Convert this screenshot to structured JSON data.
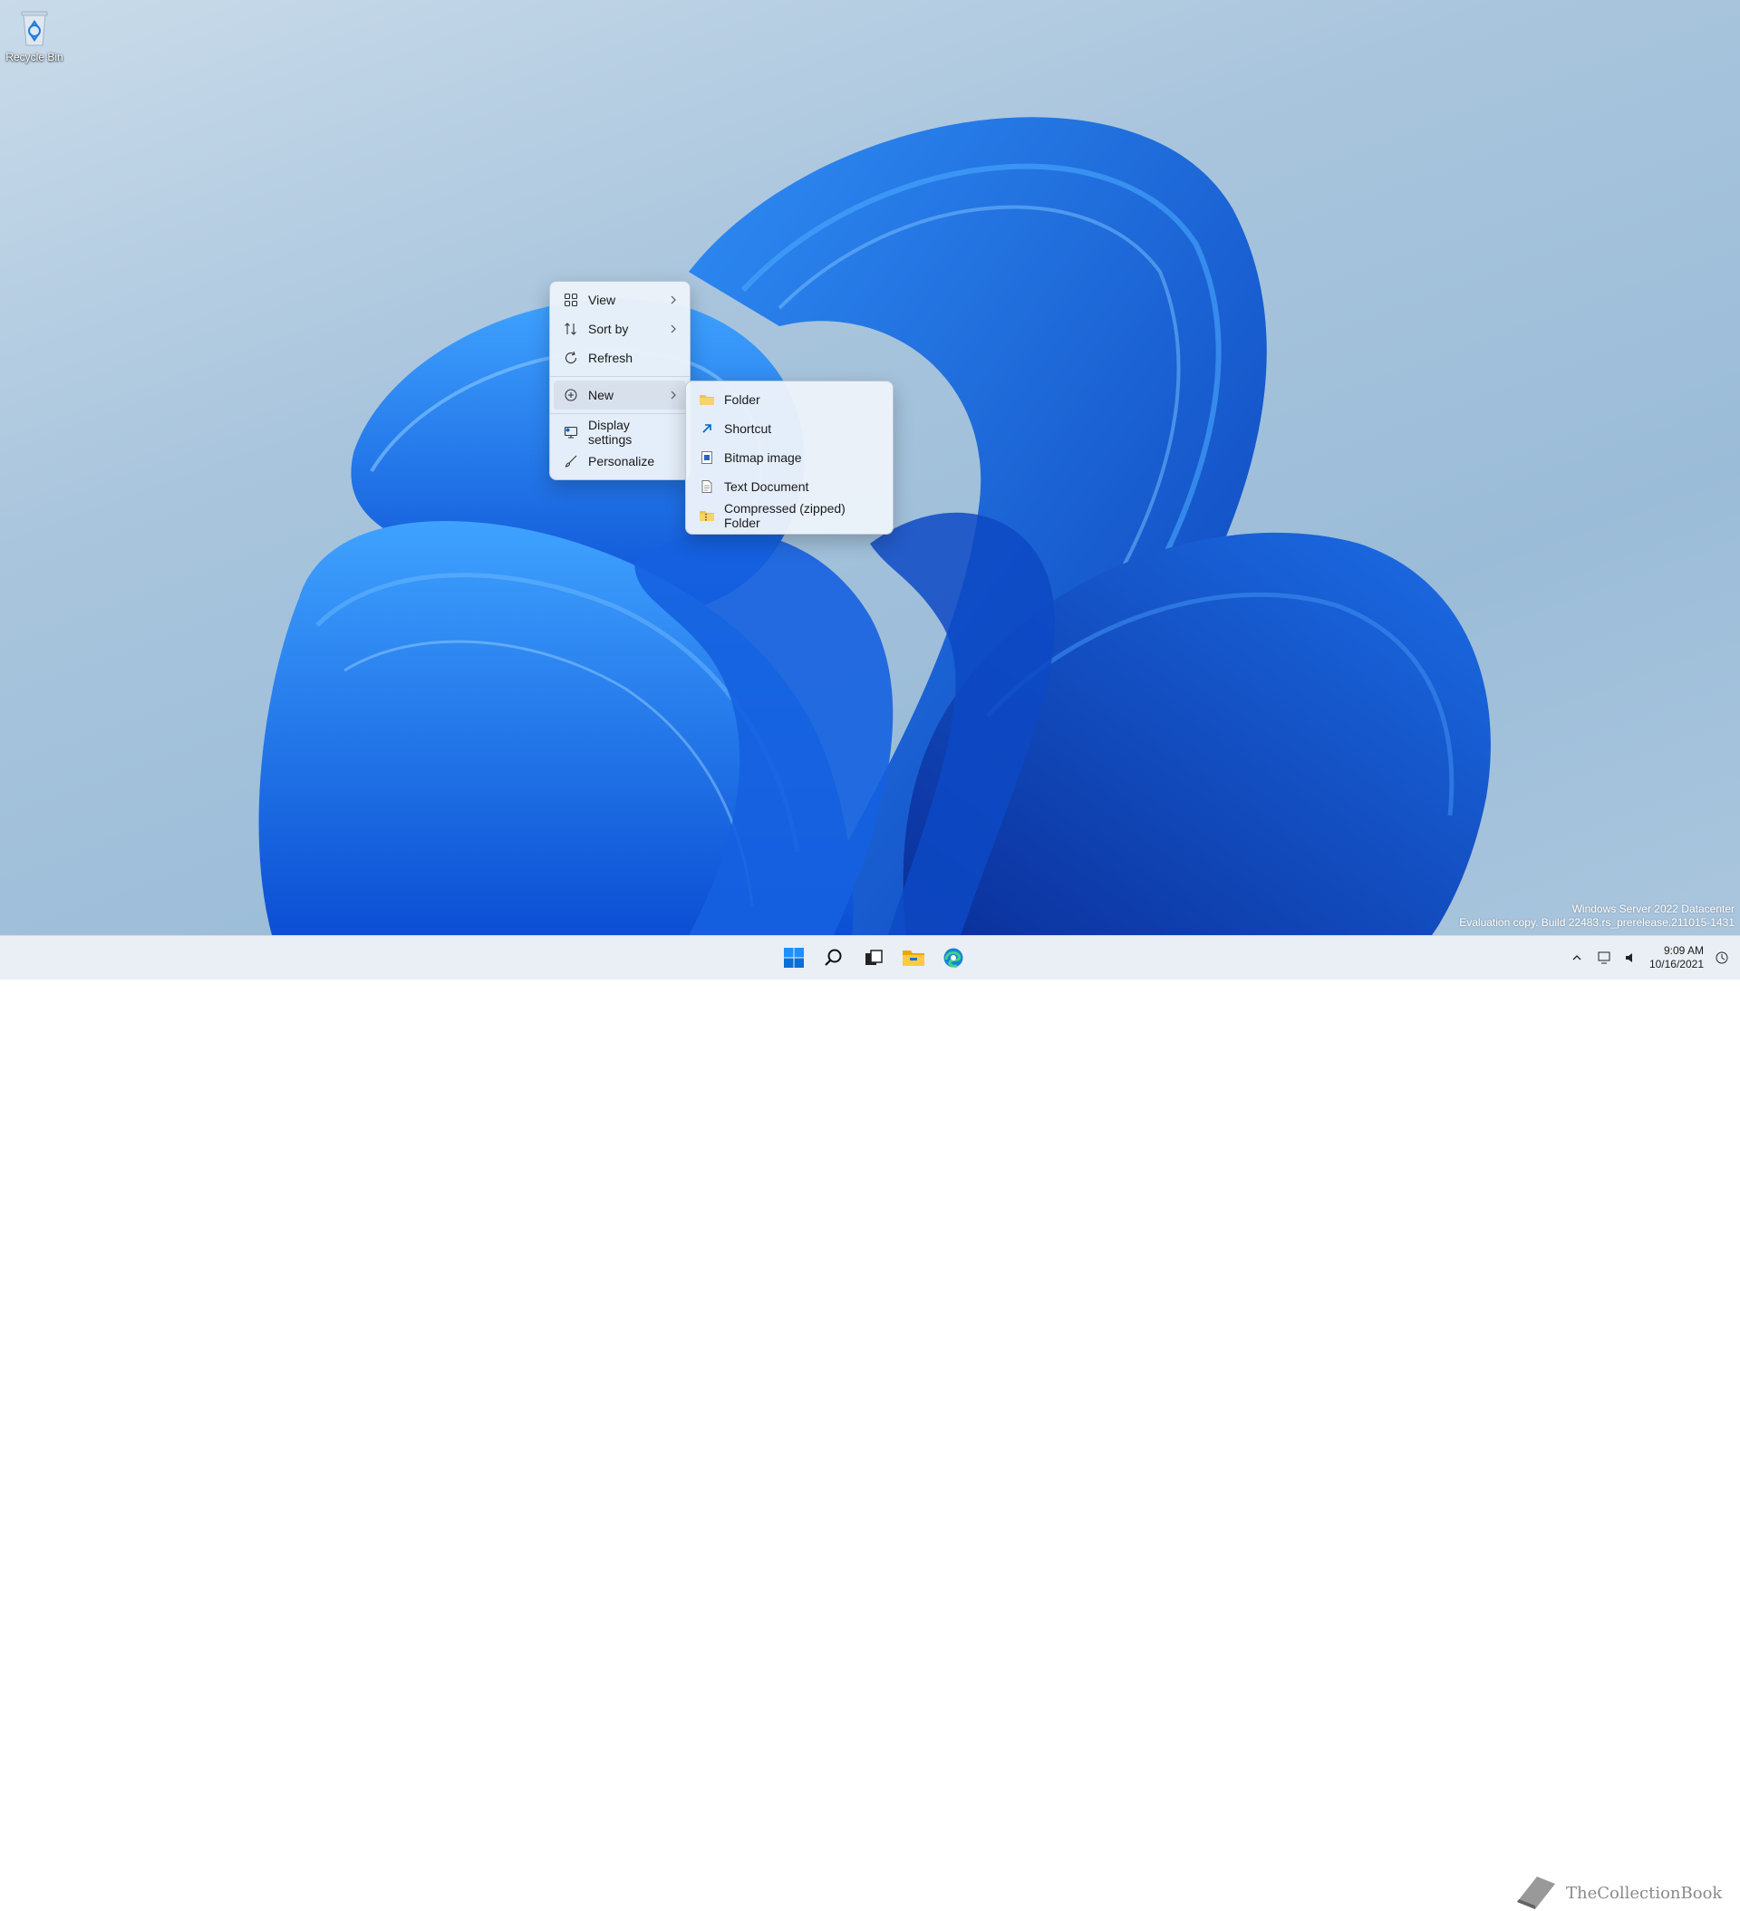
{
  "desktop": {
    "icons": [
      {
        "label": "Recycle Bin",
        "icon": "recycle-bin-icon"
      }
    ]
  },
  "context_menu": {
    "items": [
      {
        "label": "View",
        "icon": "view-grid-icon",
        "submenu": true
      },
      {
        "label": "Sort by",
        "icon": "sort-icon",
        "submenu": true
      },
      {
        "label": "Refresh",
        "icon": "refresh-icon",
        "submenu": false
      },
      {
        "label": "New",
        "icon": "new-plus-icon",
        "submenu": true,
        "hovered": true
      },
      {
        "label": "Display settings",
        "icon": "display-settings-icon",
        "submenu": false
      },
      {
        "label": "Personalize",
        "icon": "personalize-brush-icon",
        "submenu": false
      }
    ]
  },
  "new_submenu": {
    "items": [
      {
        "label": "Folder",
        "icon": "folder-icon"
      },
      {
        "label": "Shortcut",
        "icon": "shortcut-arrow-icon"
      },
      {
        "label": "Bitmap image",
        "icon": "bitmap-image-icon"
      },
      {
        "label": "Text Document",
        "icon": "text-document-icon"
      },
      {
        "label": "Compressed (zipped) Folder",
        "icon": "zip-folder-icon"
      }
    ]
  },
  "watermark": {
    "line1": "Windows Server 2022 Datacenter",
    "line2": "Evaluation copy. Build 22483.rs_prerelease.211015-1431"
  },
  "taskbar": {
    "apps": [
      "start-icon",
      "search-icon",
      "task-view-icon",
      "file-explorer-icon",
      "edge-icon"
    ],
    "brand_text": "TheCollectionBook",
    "clock": {
      "time": "9:09 AM",
      "date": "10/16/2021"
    }
  },
  "colors": {
    "accent": "#0067c0",
    "menu_bg": "#ecf2fa",
    "folder": "#f2c14e"
  }
}
